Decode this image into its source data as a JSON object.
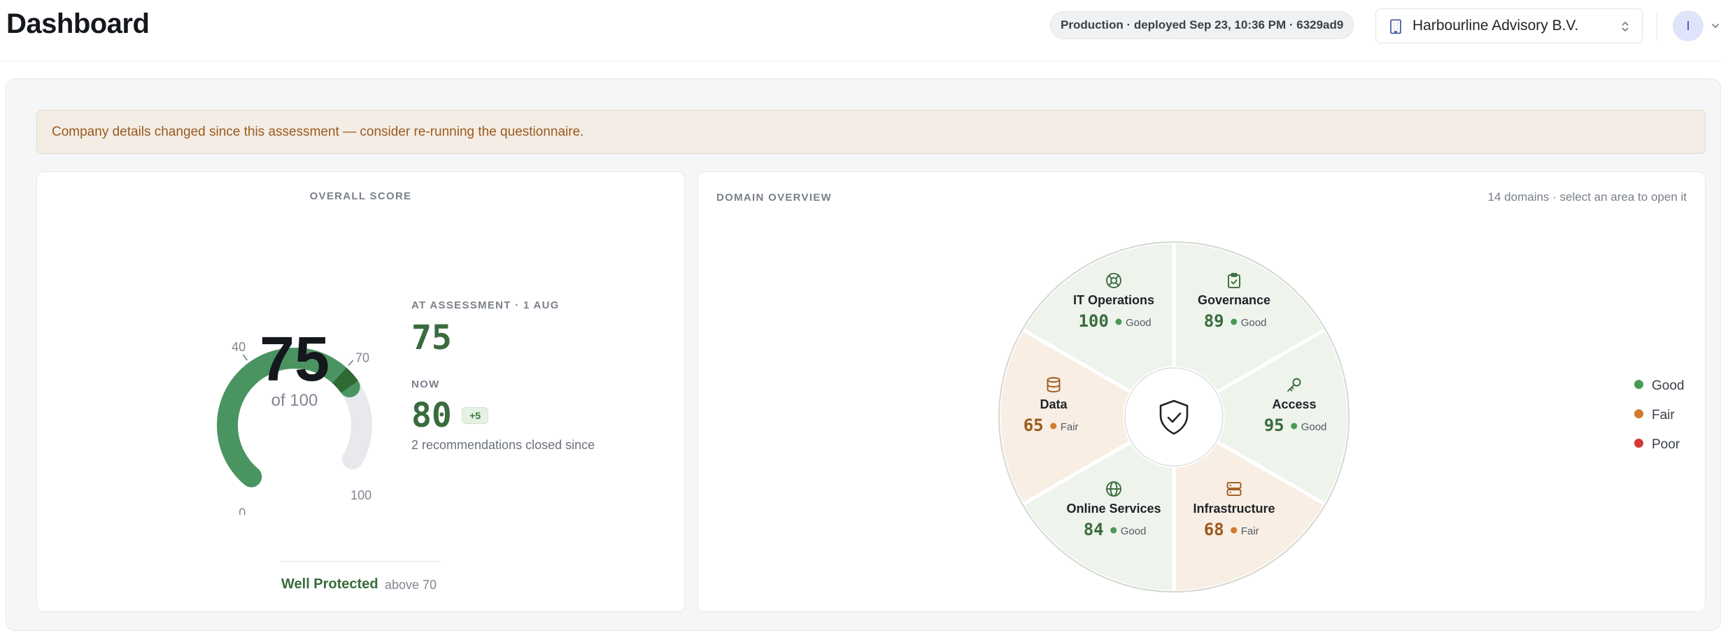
{
  "header": {
    "title": "Dashboard",
    "deploy_info": "Production · deployed Sep 23, 10:36 PM · 6329ad9",
    "org_name": "Harbourline Advisory B.V.",
    "avatar_initial": "I"
  },
  "banner": {
    "message": "Company details changed since this assessment — consider re-running the questionnaire."
  },
  "overall": {
    "title": "OVERALL SCORE",
    "score": "75",
    "of_label": "of 100",
    "score_value": 75,
    "band_marker_from": 70,
    "band_marker_to": 75,
    "ticks": {
      "t0": "0",
      "t40": "40",
      "t70": "70",
      "t100": "100"
    },
    "assessment_label": "AT ASSESSMENT · 1 AUG",
    "assessment_value": "75",
    "now_label": "NOW",
    "now_value": "80",
    "delta": "+5",
    "recs_closed": "2 recommendations closed since",
    "band_name": "Well Protected",
    "band_desc": "above 70"
  },
  "domains": {
    "title": "DOMAIN OVERVIEW",
    "hint": "14 domains · select an area to open it",
    "items": [
      {
        "name": "Governance",
        "score": "89",
        "status": "Good",
        "icon": "clipboard-check-icon"
      },
      {
        "name": "Access",
        "score": "95",
        "status": "Good",
        "icon": "key-icon"
      },
      {
        "name": "Infrastructure",
        "score": "68",
        "status": "Fair",
        "icon": "server-icon"
      },
      {
        "name": "Online Services",
        "score": "84",
        "status": "Good",
        "icon": "globe-icon"
      },
      {
        "name": "Data",
        "score": "65",
        "status": "Fair",
        "icon": "database-icon"
      },
      {
        "name": "IT Operations",
        "score": "100",
        "status": "Good",
        "icon": "lifebuoy-icon"
      }
    ],
    "center_icon": "shield-check-icon",
    "legend": [
      {
        "label": "Good",
        "color": "#4a9a55"
      },
      {
        "label": "Fair",
        "color": "#d07a2e"
      },
      {
        "label": "Poor",
        "color": "#d13b34"
      }
    ]
  },
  "colors": {
    "good_text": "#3a6b3d",
    "fair_text": "#9a5a1c",
    "good_fill": "#eef4ec",
    "fair_fill": "#f8eee3",
    "gauge_green": "#4a9461",
    "gauge_dark": "#2f6a34",
    "gauge_track": "#e8e9ec"
  }
}
